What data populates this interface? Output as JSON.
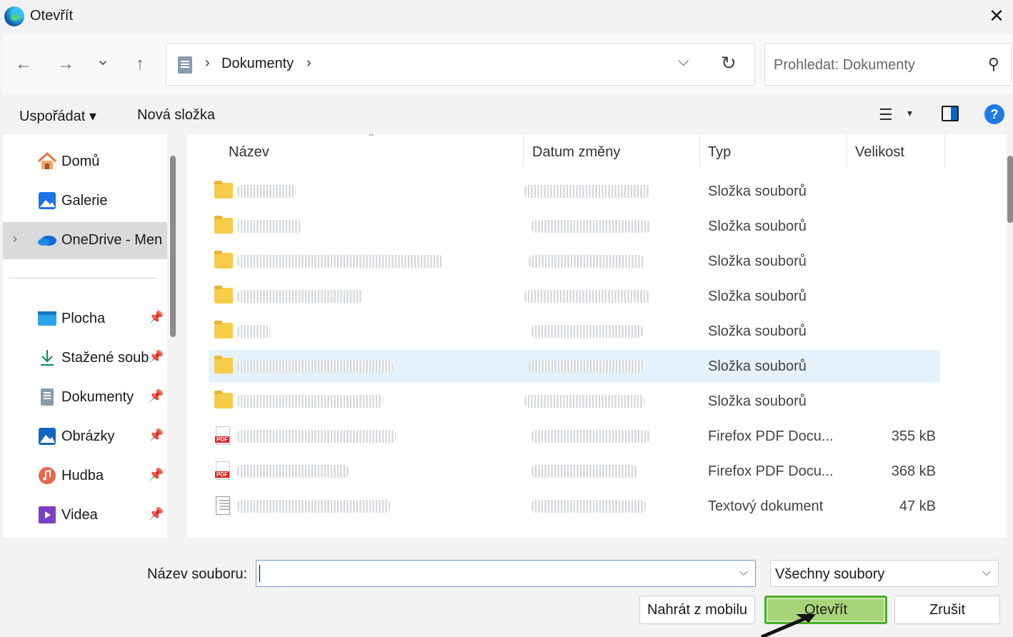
{
  "window": {
    "title": "Otevřít",
    "close_glyph": "✕"
  },
  "nav": {
    "back_glyph": "←",
    "forward_glyph": "→",
    "recent_glyph": "⌄",
    "up_glyph": "↑",
    "breadcrumb": [
      "Dokumenty"
    ],
    "sep_glyph": "›",
    "dropdown_glyph": "⌵",
    "refresh_glyph": "↻"
  },
  "search": {
    "placeholder": "Prohledat: Dokumenty",
    "icon_glyph": "⚲"
  },
  "toolbar": {
    "organize_label": "Uspořádat ▾",
    "new_folder_label": "Nová složka",
    "view_glyph": "☰",
    "view_caret": "▾",
    "help_glyph": "?"
  },
  "sidebar": {
    "items": [
      {
        "label": "Domů",
        "icon": "home-icon"
      },
      {
        "label": "Galerie",
        "icon": "gallery-icon"
      },
      {
        "label": "OneDrive - Men",
        "icon": "onedrive-icon",
        "selected": true
      },
      {
        "label": "Plocha",
        "icon": "desktop-icon",
        "pinned": true
      },
      {
        "label": "Stažené soub",
        "icon": "download-icon",
        "pinned": true
      },
      {
        "label": "Dokumenty",
        "icon": "documents-icon",
        "pinned": true
      },
      {
        "label": "Obrázky",
        "icon": "pictures-icon",
        "pinned": true
      },
      {
        "label": "Hudba",
        "icon": "music-icon",
        "pinned": true
      },
      {
        "label": "Videa",
        "icon": "videos-icon",
        "pinned": true
      }
    ],
    "expand_glyph": "›",
    "pin_glyph": "📌"
  },
  "columns": {
    "name": "Název",
    "date": "Datum změny",
    "type": "Typ",
    "size": "Velikost",
    "sort_glyph": "⌃"
  },
  "files": [
    {
      "type": "Složka souborů",
      "size": "",
      "icon": "folder-icon"
    },
    {
      "type": "Složka souborů",
      "size": "",
      "icon": "folder-icon"
    },
    {
      "type": "Složka souborů",
      "size": "",
      "icon": "folder-icon"
    },
    {
      "type": "Složka souborů",
      "size": "",
      "icon": "folder-icon"
    },
    {
      "type": "Složka souborů",
      "size": "",
      "icon": "folder-icon"
    },
    {
      "type": "Složka souborů",
      "size": "",
      "icon": "folder-icon",
      "selected": true
    },
    {
      "type": "Složka souborů",
      "size": "",
      "icon": "folder-icon"
    },
    {
      "type": "Firefox PDF Docu...",
      "size": "355 kB",
      "icon": "pdf-icon"
    },
    {
      "type": "Firefox PDF Docu...",
      "size": "368 kB",
      "icon": "pdf-icon"
    },
    {
      "type": "Textový dokument",
      "size": "47 kB",
      "icon": "text-file-icon"
    }
  ],
  "bottom": {
    "filename_label": "Název souboru:",
    "filename_value": "",
    "filetype_value": "Všechny soubory",
    "dropdown_glyph": "⌵",
    "upload_label": "Nahrát z mobilu",
    "open_label": "Otevřít",
    "cancel_label": "Zrušit"
  }
}
